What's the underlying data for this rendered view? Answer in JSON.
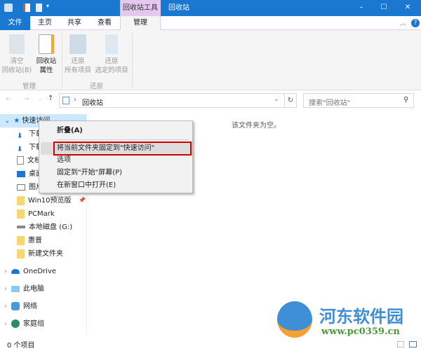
{
  "titlebar": {
    "context_tab": "回收站工具",
    "title": "回收站",
    "minimize": "–",
    "maximize": "☐",
    "close": "✕"
  },
  "tabs": [
    "文件",
    "主页",
    "共享",
    "查看",
    "管理"
  ],
  "ribbon": {
    "empty_line1": "清空",
    "empty_line2": "回收站(B)",
    "props_line1": "回收站",
    "props_line2": "属性",
    "group_manage": "管理",
    "restore_all_1": "还原",
    "restore_all_2": "所有项目",
    "restore_sel_1": "还原",
    "restore_sel_2": "选定的项目",
    "group_restore": "还原"
  },
  "address": {
    "path": "回收站",
    "search_placeholder": "搜索\"回收站\""
  },
  "content": {
    "empty_message": "该文件夹为空。"
  },
  "nav": {
    "quick_access": "快速访问",
    "items": [
      "下载",
      "下载",
      "文档",
      "桌面",
      "图片",
      "Win10预览版",
      "PCMark",
      "本地磁盘 (G:)",
      "惠普",
      "新建文件夹"
    ],
    "onedrive": "OneDrive",
    "thispc": "此电脑",
    "network": "网络",
    "homegroup": "家庭组"
  },
  "menu": {
    "items": [
      "折叠(A)",
      "将当前文件夹固定到\"快速访问\"",
      "选项",
      "固定到\"开始\"屏幕(P)",
      "在新窗口中打开(E)"
    ]
  },
  "status": {
    "count": "0 个项目"
  },
  "watermark": {
    "name": "河东软件园",
    "url": "www.pc0359.cn"
  },
  "colors": {
    "accent": "#1a78d0",
    "context": "#e4c8ee",
    "highlight": "#d00000"
  }
}
